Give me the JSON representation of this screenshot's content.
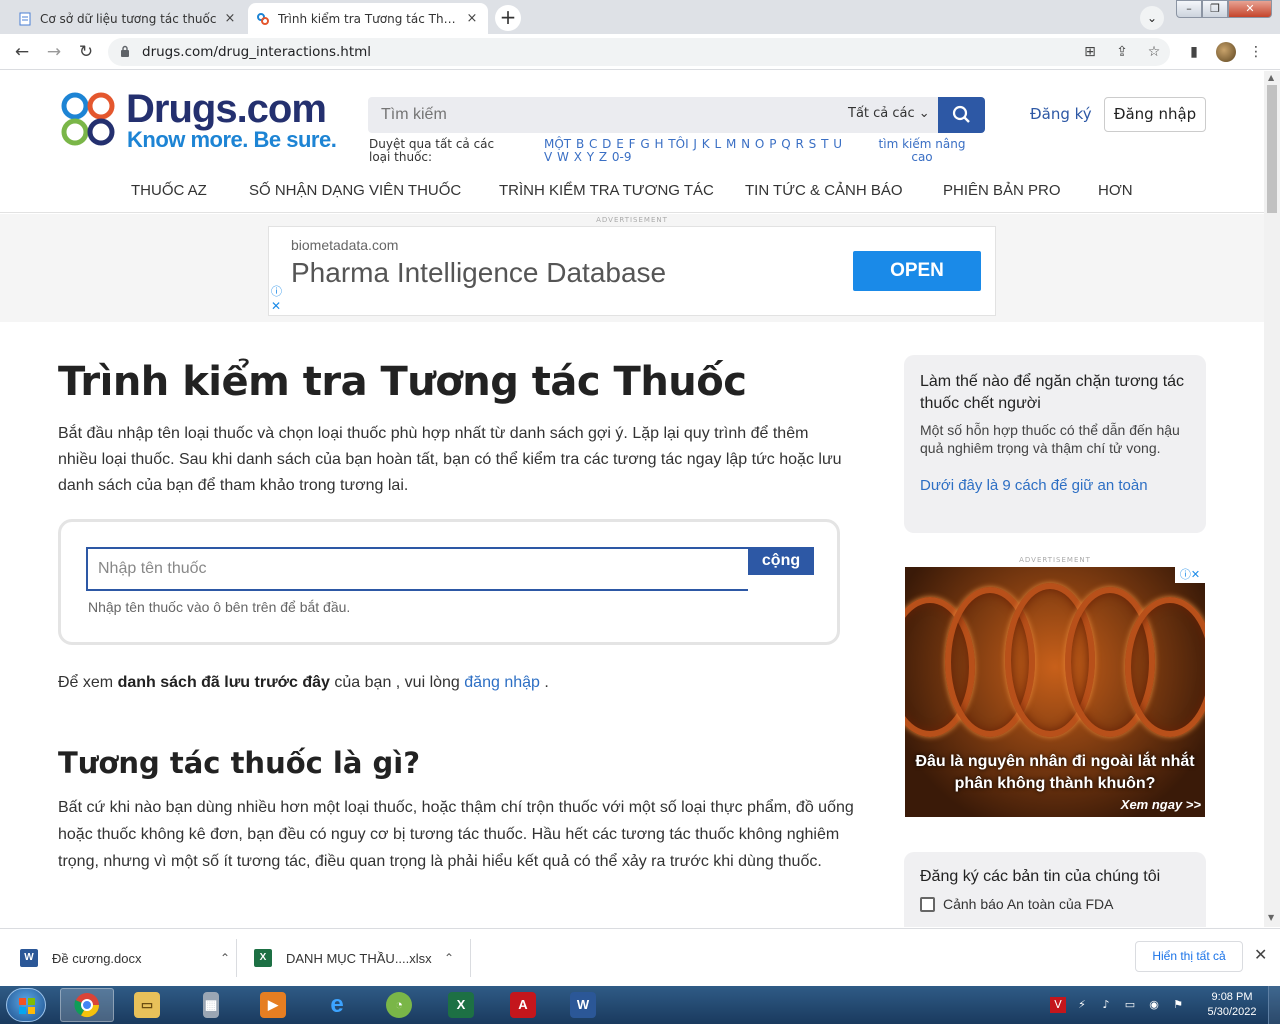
{
  "browser": {
    "tabs": [
      {
        "title": "Cơ sở dữ liệu tương tác thuốc",
        "active": false
      },
      {
        "title": "Trình kiểm tra Tương tác Thuốc - Drugs.com",
        "active": true
      }
    ],
    "url": "drugs.com/drug_interactions.html",
    "new_tab_label": "+",
    "close_tab_label": "×"
  },
  "site": {
    "brand": "Drugs.com",
    "tagline": "Know more. Be sure.",
    "search_placeholder": "Tìm kiếm",
    "search_scope": "Tất cả các",
    "browse_label": "Duyệt qua tất cả các loại thuốc:",
    "az_links": "MỘT B C D E F G H TÔI J K L M N O P Q R S T U V W X Y Z 0-9",
    "advanced_search": "tìm kiếm nâng cao",
    "signup": "Đăng ký",
    "login": "Đăng nhập",
    "nav": [
      "THUỐC AZ",
      "SỐ NHẬN DẠNG VIÊN THUỐC",
      "TRÌNH KIỂM TRA TƯƠNG TÁC",
      "TIN TỨC & CẢNH BÁO",
      "PHIÊN BẢN PRO",
      "HƠN"
    ]
  },
  "top_ad": {
    "label": "ADVERTISEMENT",
    "domain": "biometadata.com",
    "headline": "Pharma Intelligence Database",
    "cta": "OPEN"
  },
  "main": {
    "title": "Trình kiểm tra Tương tác Thuốc",
    "intro": "Bắt đầu nhập tên loại thuốc và chọn loại thuốc phù hợp nhất từ danh sách gợi ý. Lặp lại quy trình để thêm nhiều loại thuốc. Sau khi danh sách của bạn hoàn tất, bạn có thể kiểm tra các tương tác ngay lập tức hoặc lưu danh sách của bạn để tham khảo trong tương lai.",
    "drug_input_placeholder": "Nhập tên thuốc",
    "add_button": "cộng",
    "hint": "Nhập tên thuốc vào ô bên trên để bắt đầu.",
    "saved_prefix": "Để xem",
    "saved_bold": "danh sách đã lưu trước đây",
    "saved_mid": "của bạn , vui lòng",
    "saved_link": "đăng nhập",
    "saved_suffix": ".",
    "h2": "Tương tác thuốc là gì?",
    "body": "Bất cứ khi nào bạn dùng nhiều hơn một loại thuốc, hoặc thậm chí trộn thuốc với một số loại thực phẩm, đồ uống hoặc thuốc không kê đơn, bạn đều có nguy cơ bị tương tác thuốc. Hầu hết các tương tác thuốc không nghiêm trọng, nhưng vì một số ít tương tác, điều quan trọng là phải hiểu kết quả có thể xảy ra trước khi dùng thuốc."
  },
  "sidebar": {
    "card1_title": "Làm thế nào để ngăn chặn tương tác thuốc chết người",
    "card1_desc": "Một số hỗn hợp thuốc có thể dẫn đến hậu quả nghiêm trọng và thậm chí tử vong.",
    "card1_link": "Dưới đây là 9 cách để giữ an toàn",
    "ad_label": "ADVERTISEMENT",
    "ad_caption": "Đâu là nguyên nhân đi ngoài lắt nhắt phân không thành khuôn?",
    "ad_more": "Xem ngay >>",
    "card2_title": "Đăng ký các bản tin của chúng tôi",
    "card2_checkbox": "Cảnh báo An toàn của FDA"
  },
  "downloads": {
    "items": [
      {
        "name": "Đề cương.docx",
        "type": "word"
      },
      {
        "name": "DANH MỤC THẦU....xlsx",
        "type": "excel"
      }
    ],
    "show_all": "Hiển thị tất cả"
  },
  "taskbar": {
    "time": "9:08 PM",
    "date": "5/30/2022"
  },
  "colors": {
    "brand_navy": "#24306f",
    "brand_blue": "#1d84d4",
    "accent": "#2d58a5"
  }
}
